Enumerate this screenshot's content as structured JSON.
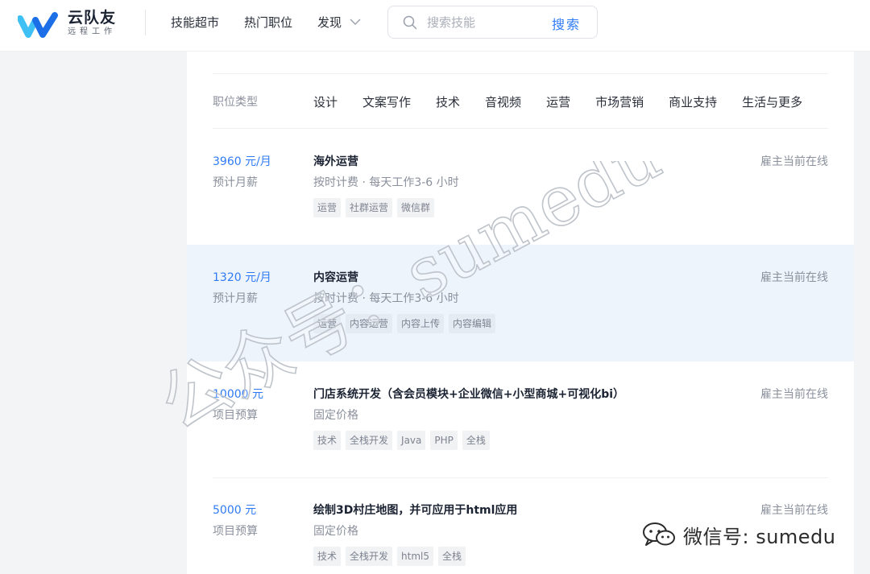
{
  "brand": {
    "name": "云队友",
    "tagline": "远程工作",
    "colors": {
      "primary": "#2f7bf6",
      "logo_light": "#3ec0f5",
      "logo_dark": "#1d6fe8"
    }
  },
  "nav": {
    "items": [
      "技能超市",
      "热门职位",
      "发现"
    ]
  },
  "search": {
    "placeholder": "搜索技能",
    "button": "搜索"
  },
  "filters": {
    "label": "职位类型",
    "options": [
      "设计",
      "文案写作",
      "技术",
      "音视频",
      "运营",
      "市场营销",
      "商业支持",
      "生活与更多"
    ]
  },
  "jobs": [
    {
      "salary": "3960 元/月",
      "salary_note": "预计月薪",
      "title": "海外运营",
      "meta": "按时计费 · 每天工作3-6 小时",
      "tags": [
        "运营",
        "社群运营",
        "微信群"
      ],
      "status": "雇主当前在线"
    },
    {
      "salary": "1320 元/月",
      "salary_note": "预计月薪",
      "title": "内容运营",
      "meta": "按时计费 · 每天工作3-6 小时",
      "tags": [
        "运营",
        "内容运营",
        "内容上传",
        "内容编辑"
      ],
      "status": "雇主当前在线"
    },
    {
      "salary": "10000 元",
      "salary_note": "项目预算",
      "title": "门店系统开发（含会员模块+企业微信+小型商城+可视化bi）",
      "meta": "固定价格",
      "tags": [
        "技术",
        "全栈开发",
        "Java",
        "PHP",
        "全栈"
      ],
      "status": "雇主当前在线"
    },
    {
      "salary": "5000 元",
      "salary_note": "项目预算",
      "title": "绘制3D村庄地图，并可应用于html应用",
      "meta": "固定价格",
      "tags": [
        "技术",
        "全栈开发",
        "html5",
        "全栈"
      ],
      "status": "雇主当前在线"
    }
  ],
  "watermark": {
    "diagonal": "公众号：sumedu",
    "footer": "微信号: sumedu"
  }
}
